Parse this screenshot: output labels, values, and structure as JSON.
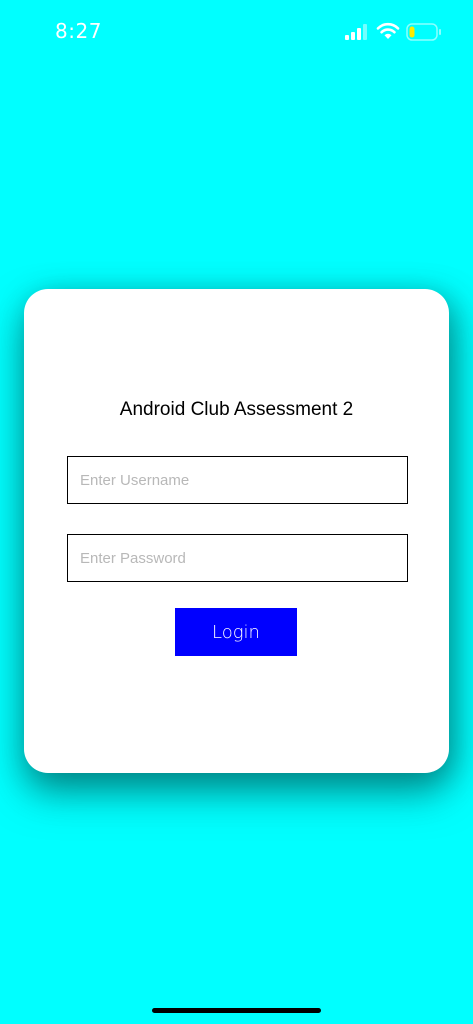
{
  "status_bar": {
    "time": "8:27",
    "icons": [
      "signal-icon",
      "wifi-icon",
      "battery-icon"
    ],
    "battery_level": 0.2
  },
  "login_card": {
    "title": "Android Club Assessment 2",
    "username": {
      "placeholder": "Enter Username",
      "value": ""
    },
    "password": {
      "placeholder": "Enter Password",
      "value": ""
    },
    "login_label": "Login"
  },
  "colors": {
    "background": "#00ffff",
    "card": "#ffffff",
    "button": "#0000ff",
    "battery_fill": "#ffeb00"
  }
}
